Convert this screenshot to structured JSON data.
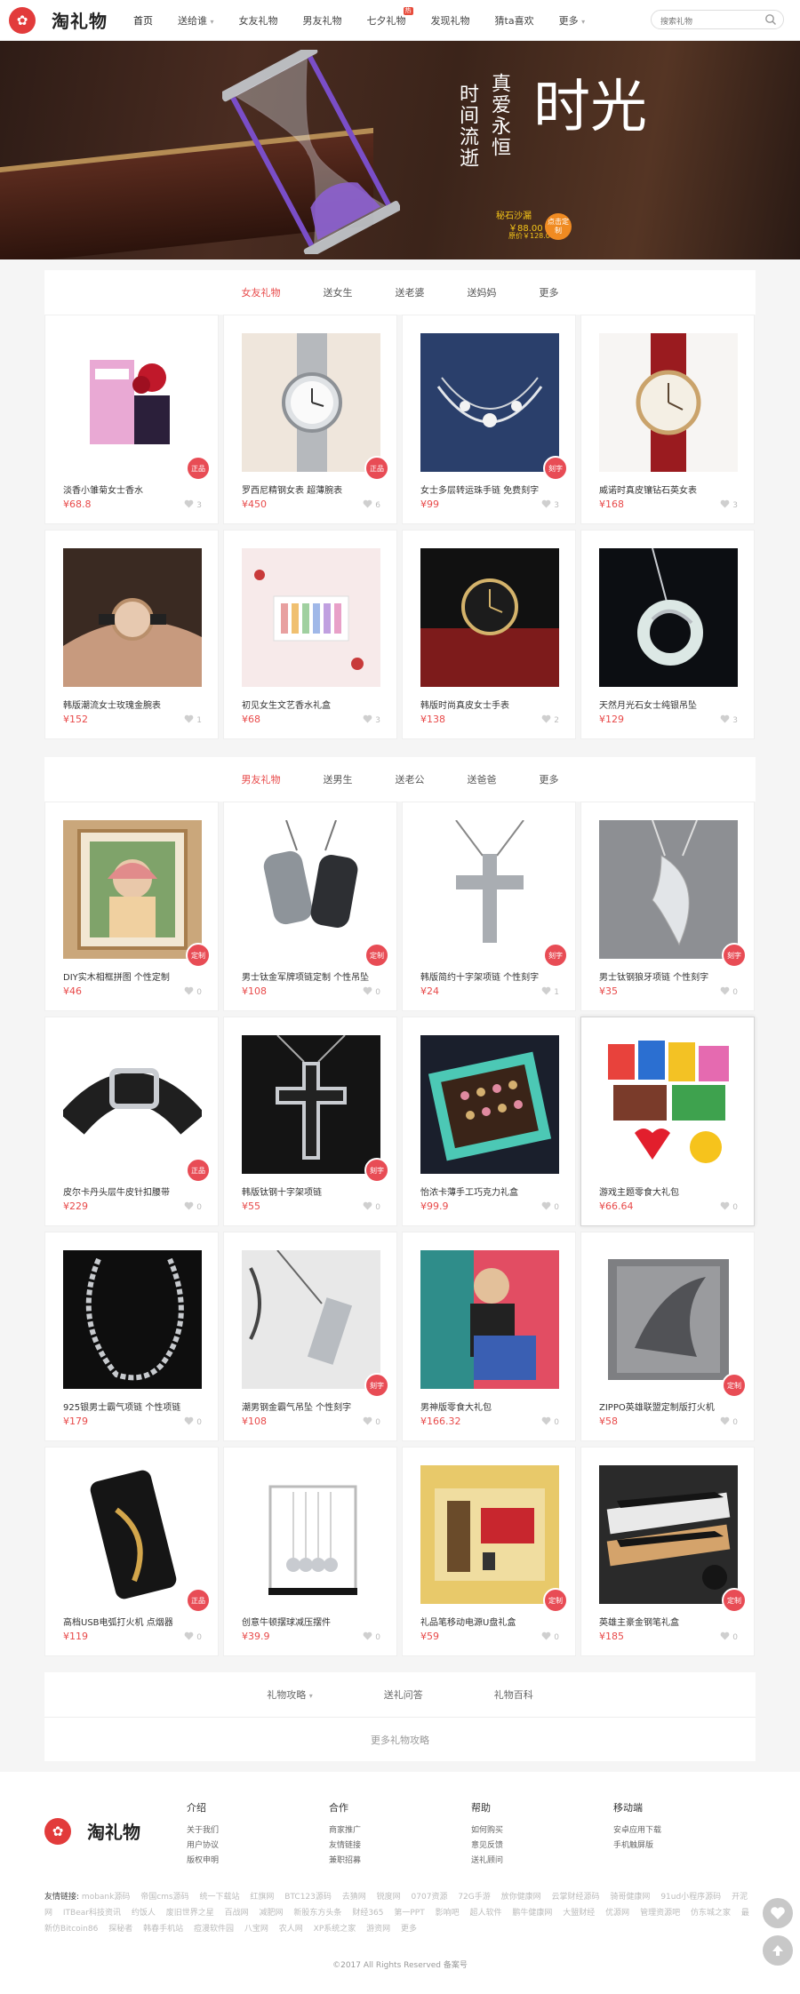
{
  "header": {
    "logo_text": "淘礼物",
    "nav": [
      "首页",
      "送给谁",
      "女友礼物",
      "男友礼物",
      "七夕礼物",
      "发现礼物",
      "猜ta喜欢",
      "更多"
    ],
    "nav_badge": "热",
    "search_placeholder": "搜索礼物"
  },
  "banner": {
    "col1": "时间流逝",
    "col2": "真爱永恒",
    "big": "时光",
    "product": "秘石沙漏",
    "price": "￥88.00",
    "old_price": "原价￥128.00",
    "badge": "点击定制"
  },
  "section1": {
    "tabs": [
      "女友礼物",
      "送女生",
      "送老婆",
      "送妈妈",
      "更多"
    ],
    "items": [
      {
        "title": "淡香小雏菊女士香水",
        "price": "¥68.8",
        "likes": "3",
        "tag": "正品",
        "icon": "perfume"
      },
      {
        "title": "罗西尼精钢女表 超薄腕表",
        "price": "¥450",
        "likes": "6",
        "tag": "正品",
        "icon": "steel-watch"
      },
      {
        "title": "女士多层转运珠手链 免费刻字",
        "price": "¥99",
        "likes": "3",
        "tag": "刻字",
        "icon": "bracelet"
      },
      {
        "title": "威诺时真皮镶钻石英女表",
        "price": "¥168",
        "likes": "3",
        "tag": "",
        "icon": "leather-watch"
      },
      {
        "title": "韩版潮流女士玫瑰金腕表",
        "price": "¥152",
        "likes": "1",
        "tag": "",
        "icon": "wrist-watch"
      },
      {
        "title": "初见女生文艺香水礼盒",
        "price": "¥68",
        "likes": "3",
        "tag": "",
        "icon": "perfume-box"
      },
      {
        "title": "韩版时尚真皮女士手表",
        "price": "¥138",
        "likes": "2",
        "tag": "",
        "icon": "red-watch"
      },
      {
        "title": "天然月光石女士纯银吊坠",
        "price": "¥129",
        "likes": "3",
        "tag": "",
        "icon": "moon-pendant"
      }
    ]
  },
  "section2": {
    "tabs": [
      "男友礼物",
      "送男生",
      "送老公",
      "送爸爸",
      "更多"
    ],
    "items": [
      {
        "title": "DIY实木相框拼图 个性定制",
        "price": "¥46",
        "likes": "0",
        "tag": "定制",
        "icon": "photo-frame"
      },
      {
        "title": "男士钛金军牌项链定制 个性吊坠",
        "price": "¥108",
        "likes": "0",
        "tag": "定制",
        "icon": "dog-tags"
      },
      {
        "title": "韩版简约十字架项链 个性刻字",
        "price": "¥24",
        "likes": "1",
        "tag": "刻字",
        "icon": "cross-necklace"
      },
      {
        "title": "男士钛钢狼牙项链 个性刻字",
        "price": "¥35",
        "likes": "0",
        "tag": "刻字",
        "icon": "fang-pendant"
      },
      {
        "title": "皮尔卡丹头层牛皮针扣腰带",
        "price": "¥229",
        "likes": "0",
        "tag": "正品",
        "icon": "belt"
      },
      {
        "title": "韩版钛钢十字架项链",
        "price": "¥55",
        "likes": "0",
        "tag": "刻字",
        "icon": "black-cross"
      },
      {
        "title": "怡浓卡薄手工巧克力礼盒",
        "price": "¥99.9",
        "likes": "0",
        "tag": "",
        "icon": "chocolate-box"
      },
      {
        "title": "游戏主题零食大礼包",
        "price": "¥66.64",
        "likes": "0",
        "tag": "",
        "icon": "snack-pack"
      },
      {
        "title": "925银男士霸气项链 个性项链",
        "price": "¥179",
        "likes": "0",
        "tag": "",
        "icon": "silver-chain"
      },
      {
        "title": "潮男钢金霸气吊坠 个性刻字",
        "price": "¥108",
        "likes": "0",
        "tag": "刻字",
        "icon": "steel-pendant"
      },
      {
        "title": "男神版零食大礼包",
        "price": "¥166.32",
        "likes": "0",
        "tag": "",
        "icon": "man-snack"
      },
      {
        "title": "ZIPPO英雄联盟定制版打火机",
        "price": "¥58",
        "likes": "0",
        "tag": "定制",
        "icon": "zippo"
      },
      {
        "title": "高档USB电弧打火机 点烟器",
        "price": "¥119",
        "likes": "0",
        "tag": "正品",
        "icon": "usb-lighter"
      },
      {
        "title": "创意牛顿摆球减压摆件",
        "price": "¥39.9",
        "likes": "0",
        "tag": "",
        "icon": "newton-cradle"
      },
      {
        "title": "礼品笔移动电源U盘礼盒",
        "price": "¥59",
        "likes": "0",
        "tag": "定制",
        "icon": "gift-set"
      },
      {
        "title": "英雄主豪金钢笔礼盒",
        "price": "¥185",
        "likes": "0",
        "tag": "定制",
        "icon": "pen-set"
      }
    ]
  },
  "guide": {
    "links": [
      "礼物攻略",
      "送礼问答",
      "礼物百科"
    ],
    "more": "更多礼物攻略"
  },
  "footer": {
    "logo_text": "淘礼物",
    "cols": [
      {
        "title": "介绍",
        "links": [
          "关于我们",
          "用户协议",
          "版权申明"
        ]
      },
      {
        "title": "合作",
        "links": [
          "商家推广",
          "友情链接",
          "兼职招募"
        ]
      },
      {
        "title": "帮助",
        "links": [
          "如何购买",
          "意见反馈",
          "送礼顾问"
        ]
      },
      {
        "title": "移动端",
        "links": [
          "安卓应用下载",
          "手机触屏版"
        ]
      }
    ],
    "friends_label": "友情链接:",
    "friends": [
      "mobank源码",
      "帝国cms源码",
      "统一下载站",
      "红旗网",
      "BTC123源码",
      "去猜网",
      "锐度网",
      "0707资源",
      "72G手游",
      "放你健康网",
      "云掌财经源码",
      "骑哥健康网",
      "91ud小程序源码",
      "开泥网",
      "ITBear科技资讯",
      "约饭人",
      "废旧世界之星",
      "百战网",
      "减肥网",
      "新股东方头条",
      "财经365",
      "第一PPT",
      "影响吧",
      "超人软件",
      "鹏牛健康网",
      "大盟财经",
      "优源网",
      "管理资源吧",
      "仿东城之家",
      "最新仿Bitcoin86",
      "探秘者",
      "韩春手机站",
      "痘漫软件园",
      "八宝网",
      "农人网",
      "XP系统之家",
      "游资网",
      "更多"
    ],
    "copyright": "©2017 All Rights Reserved 备案号"
  },
  "colors": {
    "accent": "#e84a4a",
    "tag": "#e84c55",
    "logo": "#e23b3b",
    "background": "#f5f5f5"
  }
}
